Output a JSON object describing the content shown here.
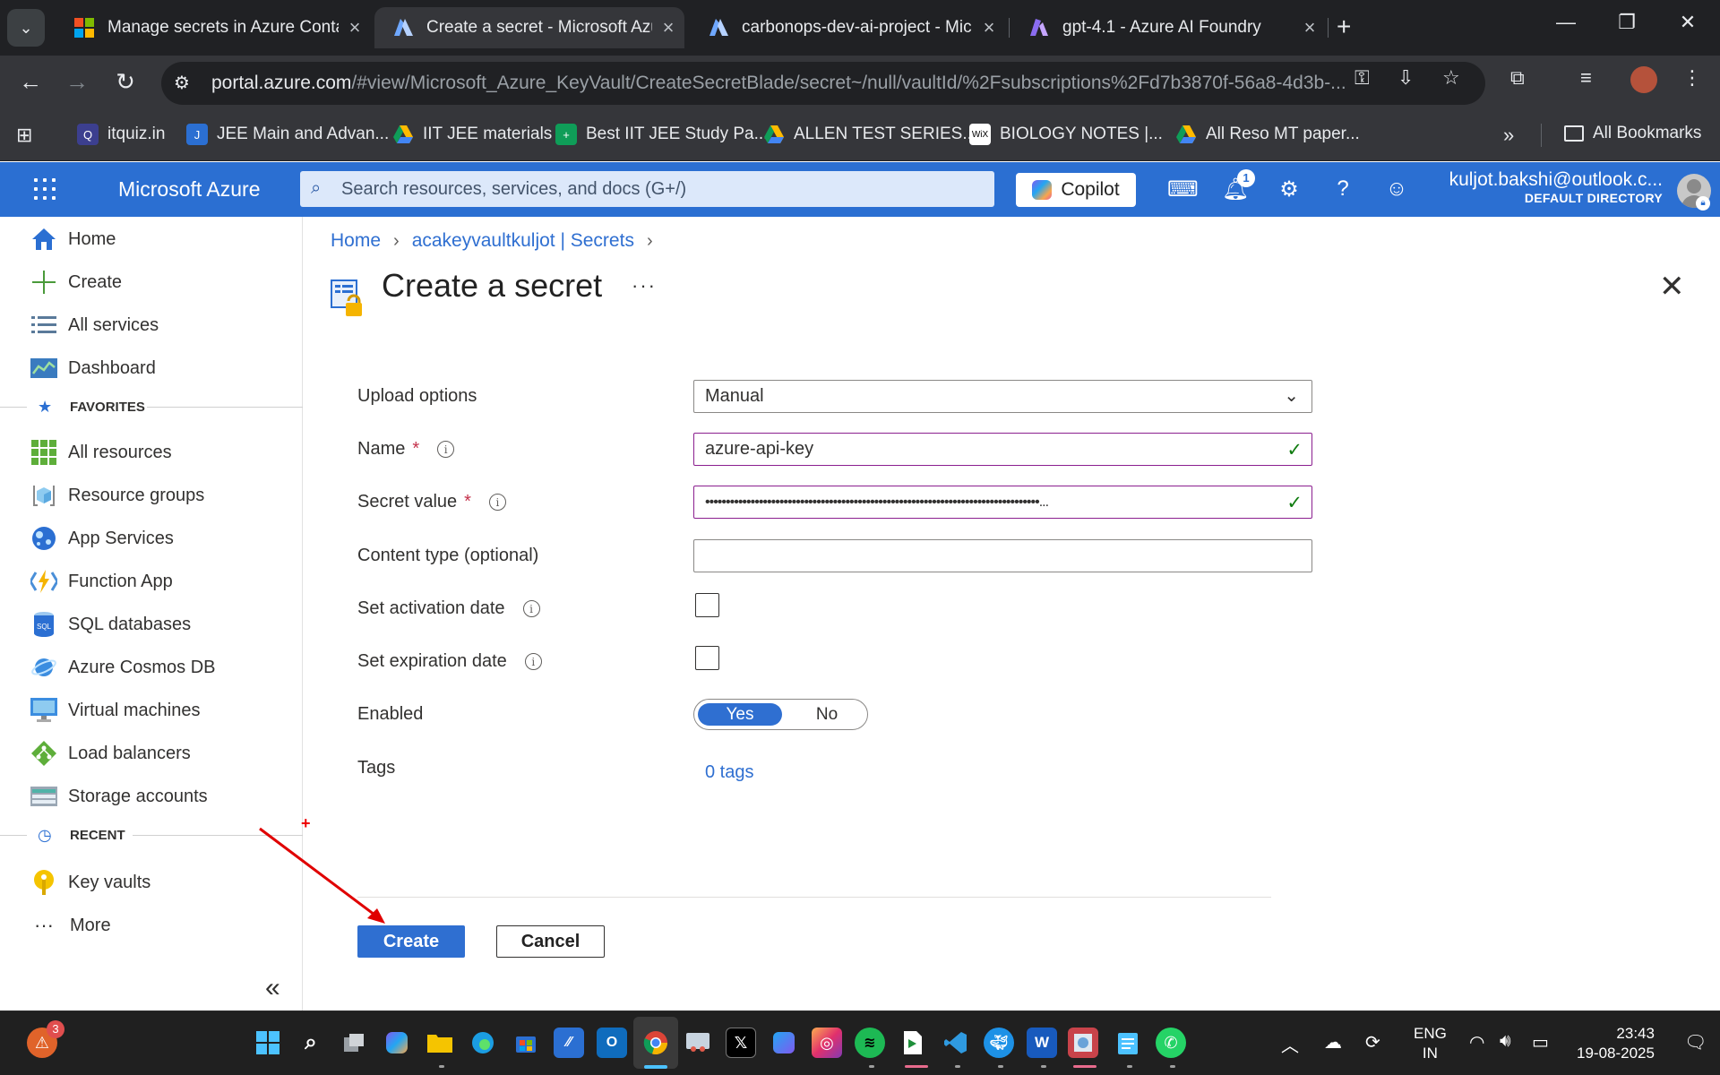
{
  "browser": {
    "tabs": [
      {
        "title": "Manage secrets in Azure Conta",
        "active": false
      },
      {
        "title": "Create a secret - Microsoft Azur",
        "active": true
      },
      {
        "title": "carbonops-dev-ai-project - Mic",
        "active": false
      },
      {
        "title": "gpt-4.1 - Azure AI Foundry",
        "active": false
      }
    ],
    "url_host": "portal.azure.com",
    "url_path": "/#view/Microsoft_Azure_KeyVault/CreateSecretBlade/secret~/null/vaultId/%2Fsubscriptions%2Fd7b3870f-56a8-4d3b-...",
    "bookmarks": [
      "itquiz.in",
      "JEE Main and Advan...",
      "IIT JEE materials",
      "Best IIT JEE Study Pa...",
      "ALLEN TEST SERIES...",
      "BIOLOGY NOTES |...",
      "All Reso MT paper..."
    ],
    "all_bookmarks": "All Bookmarks",
    "overflow": "»"
  },
  "azure": {
    "brand": "Microsoft Azure",
    "search_placeholder": "Search resources, services, and docs (G+/)",
    "copilot_label": "Copilot",
    "notification_count": "1",
    "account_email": "kuljot.bakshi@outlook.c...",
    "account_directory": "DEFAULT DIRECTORY"
  },
  "sidebar": {
    "top_items": [
      {
        "label": "Home",
        "icon": "home-icon"
      },
      {
        "label": "Create",
        "icon": "plus-icon"
      },
      {
        "label": "All services",
        "icon": "list-icon"
      },
      {
        "label": "Dashboard",
        "icon": "dashboard-icon"
      }
    ],
    "favorites_label": "FAVORITES",
    "favorites": [
      {
        "label": "All resources",
        "icon": "grid-icon"
      },
      {
        "label": "Resource groups",
        "icon": "cube-icon"
      },
      {
        "label": "App Services",
        "icon": "globe-icon"
      },
      {
        "label": "Function App",
        "icon": "bolt-icon"
      },
      {
        "label": "SQL databases",
        "icon": "sql-icon"
      },
      {
        "label": "Azure Cosmos DB",
        "icon": "planet-icon"
      },
      {
        "label": "Virtual machines",
        "icon": "monitor-icon"
      },
      {
        "label": "Load balancers",
        "icon": "diamond-icon"
      },
      {
        "label": "Storage accounts",
        "icon": "storage-icon"
      }
    ],
    "recent_label": "RECENT",
    "recent": [
      {
        "label": "Key vaults",
        "icon": "key-icon"
      }
    ],
    "more_label": "More",
    "collapse": "«"
  },
  "breadcrumb": {
    "home": "Home",
    "parent": "acakeyvaultkuljot | Secrets"
  },
  "blade": {
    "title": "Create a secret",
    "more": "···"
  },
  "form": {
    "upload_label": "Upload options",
    "upload_value": "Manual",
    "name_label": "Name",
    "name_value": "azure-api-key",
    "secret_label": "Secret value",
    "secret_value": "•••••••••••••••••••••••••••••••••••••••••••••••••••••••••••••••••••••••••••••••••...",
    "content_type_label": "Content type (optional)",
    "content_type_value": "",
    "activation_label": "Set activation date",
    "activation_checked": false,
    "expiration_label": "Set expiration date",
    "expiration_checked": false,
    "enabled_label": "Enabled",
    "enabled_yes": "Yes",
    "enabled_no": "No",
    "enabled_value": "Yes",
    "tags_label": "Tags",
    "tags_link": "0 tags",
    "required_mark": "*"
  },
  "actions": {
    "create": "Create",
    "cancel": "Cancel"
  },
  "taskbar": {
    "badge_count": "3",
    "lang_line1": "ENG",
    "lang_line2": "IN",
    "time": "23:43",
    "date": "19-08-2025"
  },
  "colors": {
    "azure_blue": "#2b6fd2",
    "primary_button": "#2f6fd1",
    "valid_field_border": "#8b1f8f",
    "check_green": "#107c10",
    "annotation_red": "#e00000"
  }
}
